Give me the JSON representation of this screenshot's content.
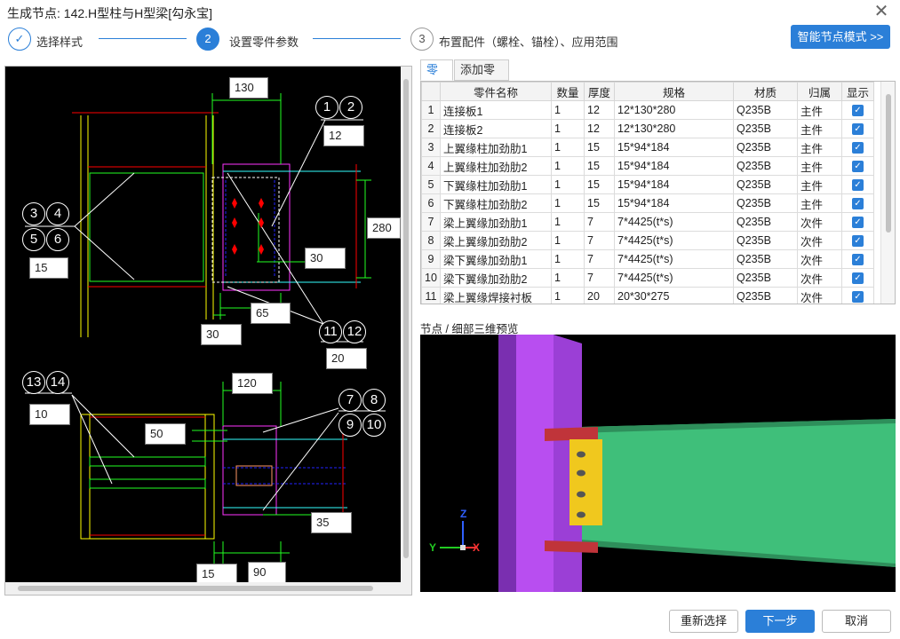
{
  "window": {
    "title": "生成节点: 142.H型柱与H型梁[勾永宝]",
    "close_glyph": "✕"
  },
  "steps": [
    {
      "number": "✓",
      "label": "选择样式"
    },
    {
      "number": "2",
      "label": "设置零件参数"
    },
    {
      "number": "3",
      "label": "布置配件（螺栓、锚栓）、应用范围"
    }
  ],
  "smart_mode_button": "智能节点模式 >>",
  "drawing": {
    "dims": {
      "d130": "130",
      "d12": "12",
      "d280": "280",
      "d15a": "15",
      "d30a": "30",
      "d65": "65",
      "d30b": "30",
      "d20": "20",
      "d120": "120",
      "d10": "10",
      "d50": "50",
      "d35": "35",
      "d15b": "15",
      "d90": "90"
    },
    "tags": {
      "t1": "1",
      "t2": "2",
      "t3": "3",
      "t4": "4",
      "t5": "5",
      "t6": "6",
      "t11": "11",
      "t12": "12",
      "t13": "13",
      "t14": "14",
      "t7": "7",
      "t8": "8",
      "t9": "9",
      "t10": "10"
    }
  },
  "tabs": {
    "parts": "零件",
    "add_parts": "添加零件"
  },
  "table": {
    "headers": [
      "",
      "零件名称",
      "数量",
      "厚度",
      "规格",
      "材质",
      "归属",
      "显示"
    ],
    "rows": [
      {
        "n": "1",
        "name": "连接板1",
        "qty": "1",
        "thk": "12",
        "spec": "12*130*280",
        "mat": "Q235B",
        "own": "主件"
      },
      {
        "n": "2",
        "name": "连接板2",
        "qty": "1",
        "thk": "12",
        "spec": "12*130*280",
        "mat": "Q235B",
        "own": "主件"
      },
      {
        "n": "3",
        "name": "上翼缘柱加劲肋1",
        "qty": "1",
        "thk": "15",
        "spec": "15*94*184",
        "mat": "Q235B",
        "own": "主件"
      },
      {
        "n": "4",
        "name": "上翼缘柱加劲肋2",
        "qty": "1",
        "thk": "15",
        "spec": "15*94*184",
        "mat": "Q235B",
        "own": "主件"
      },
      {
        "n": "5",
        "name": "下翼缘柱加劲肋1",
        "qty": "1",
        "thk": "15",
        "spec": "15*94*184",
        "mat": "Q235B",
        "own": "主件"
      },
      {
        "n": "6",
        "name": "下翼缘柱加劲肋2",
        "qty": "1",
        "thk": "15",
        "spec": "15*94*184",
        "mat": "Q235B",
        "own": "主件"
      },
      {
        "n": "7",
        "name": "梁上翼缘加劲肋1",
        "qty": "1",
        "thk": "7",
        "spec": "7*4425(t*s)",
        "mat": "Q235B",
        "own": "次件"
      },
      {
        "n": "8",
        "name": "梁上翼缘加劲肋2",
        "qty": "1",
        "thk": "7",
        "spec": "7*4425(t*s)",
        "mat": "Q235B",
        "own": "次件"
      },
      {
        "n": "9",
        "name": "梁下翼缘加劲肋1",
        "qty": "1",
        "thk": "7",
        "spec": "7*4425(t*s)",
        "mat": "Q235B",
        "own": "次件"
      },
      {
        "n": "10",
        "name": "梁下翼缘加劲肋2",
        "qty": "1",
        "thk": "7",
        "spec": "7*4425(t*s)",
        "mat": "Q235B",
        "own": "次件"
      },
      {
        "n": "11",
        "name": "梁上翼缘焊接衬板",
        "qty": "1",
        "thk": "20",
        "spec": "20*30*275",
        "mat": "Q235B",
        "own": "次件"
      }
    ]
  },
  "preview": {
    "label": "节点 / 细部三维预览",
    "axes": {
      "z": "Z",
      "y": "Y",
      "x": "X"
    },
    "colors": {
      "column": "#9b3fd6",
      "beam": "#3fbf7a",
      "plate": "#f0c81e",
      "stiffener": "#3fe0d6",
      "flange_plate": "#c0343a"
    }
  },
  "buttons": {
    "reselect": "重新选择",
    "next": "下一步",
    "cancel": "取消"
  }
}
